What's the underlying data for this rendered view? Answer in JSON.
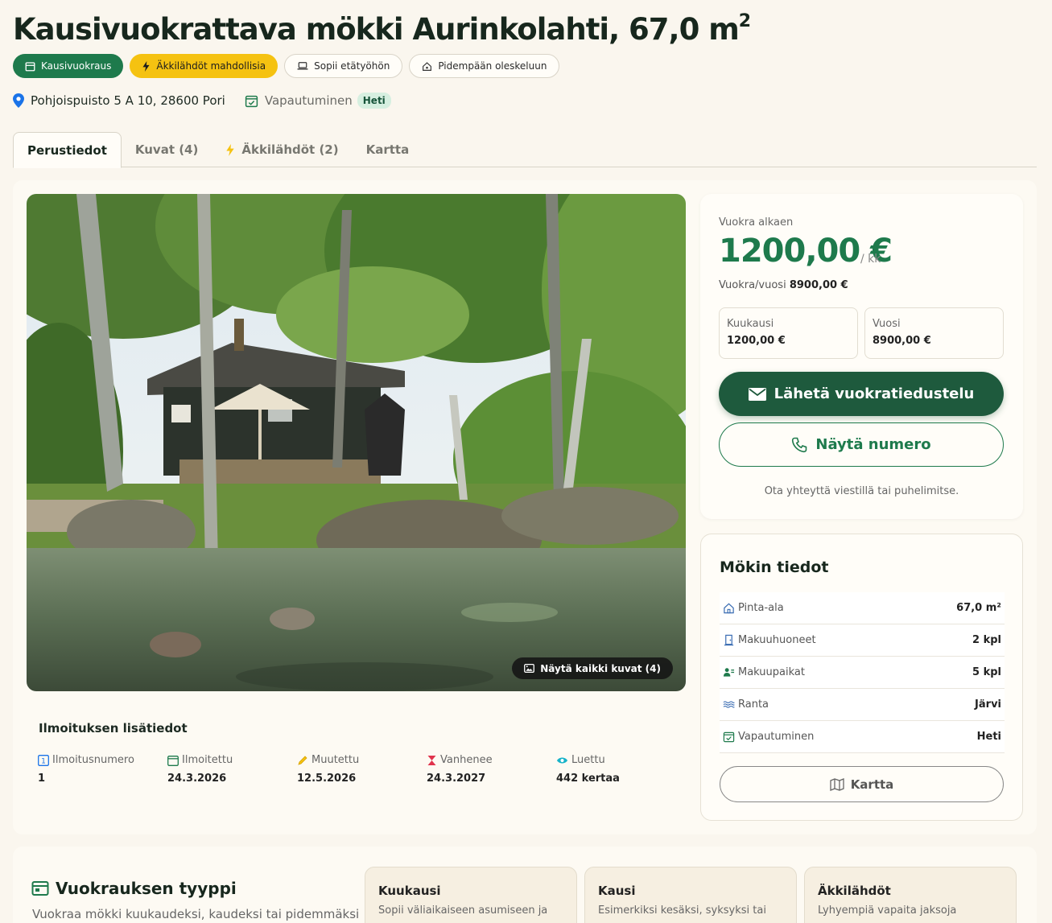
{
  "header": {
    "title": "Kausivuokrattava mökki Aurinkolahti, 67,0 m",
    "title_sup": "2",
    "badges": [
      {
        "label": "Kausivuokraus",
        "icon": "calendar-icon",
        "style": "green"
      },
      {
        "label": "Äkkilähdöt mahdollisia",
        "icon": "lightning-icon",
        "style": "yellow"
      },
      {
        "label": "Sopii etätyöhön",
        "icon": "laptop-icon",
        "style": "outline"
      },
      {
        "label": "Pidempään oleskeluun",
        "icon": "home-icon",
        "style": "outline"
      }
    ],
    "address": "Pohjoispuisto 5 A 10, 28600 Pori",
    "availability_label": "Vapautuminen",
    "availability_value": "Heti"
  },
  "tabs": [
    {
      "label": "Perustiedot",
      "active": true
    },
    {
      "label": "Kuvat (4)",
      "active": false
    },
    {
      "label": "Äkkilähdöt (2)",
      "active": false,
      "icon": "lightning-icon"
    },
    {
      "label": "Kartta",
      "active": false
    }
  ],
  "photo": {
    "show_all_label": "Näytä kaikki kuvat (4)"
  },
  "listing_info": {
    "title": "Ilmoituksen lisätiedot",
    "items": [
      {
        "label": "Ilmoitusnumero",
        "value": "1",
        "icon": "number-icon"
      },
      {
        "label": "Ilmoitettu",
        "value": "24.3.2026",
        "icon": "calendar-icon"
      },
      {
        "label": "Muutettu",
        "value": "12.5.2026",
        "icon": "pencil-icon"
      },
      {
        "label": "Vanhenee",
        "value": "24.3.2027",
        "icon": "hourglass-icon"
      },
      {
        "label": "Luettu",
        "value": "442 kertaa",
        "icon": "eye-icon"
      }
    ]
  },
  "price": {
    "label": "Vuokra alkaen",
    "amount": "1200,00 €",
    "unit": "/ kk",
    "year_label": "Vuokra/vuosi",
    "year_value": "8900,00 €",
    "boxes": [
      {
        "label": "Kuukausi",
        "value": "1200,00 €"
      },
      {
        "label": "Vuosi",
        "value": "8900,00 €"
      }
    ],
    "primary_button": "Lähetä vuokratiedustelu",
    "secondary_button": "Näytä numero",
    "note": "Ota yhteyttä viestillä tai puhelimitse."
  },
  "details": {
    "title": "Mökin tiedot",
    "rows": [
      {
        "label": "Pinta-ala",
        "value": "67,0 m²",
        "icon": "house-icon"
      },
      {
        "label": "Makuuhuoneet",
        "value": "2 kpl",
        "icon": "door-icon"
      },
      {
        "label": "Makuupaikat",
        "value": "5 kpl",
        "icon": "people-icon"
      },
      {
        "label": "Ranta",
        "value": "Järvi",
        "icon": "water-icon"
      },
      {
        "label": "Vapautuminen",
        "value": "Heti",
        "icon": "calendar-check-icon"
      }
    ],
    "map_button": "Kartta"
  },
  "rental_type": {
    "title": "Vuokrauksen tyyppi",
    "description": "Vuokraa mökki kuukaudeksi, kaudeksi tai pidemmäksi",
    "cards": [
      {
        "title": "Kuukausi",
        "desc": "Sopii väliaikaiseen asumiseen ja"
      },
      {
        "title": "Kausi",
        "desc": "Esimerkiksi kesäksi, syksyksi tai"
      },
      {
        "title": "Äkkilähdöt",
        "desc": "Lyhyempiä vapaita jaksoja"
      }
    ]
  },
  "colors": {
    "brand_green": "#1e7a4c",
    "dark_green": "#1e5a3d",
    "accent_yellow": "#f5c211",
    "background": "#faf6ee"
  }
}
